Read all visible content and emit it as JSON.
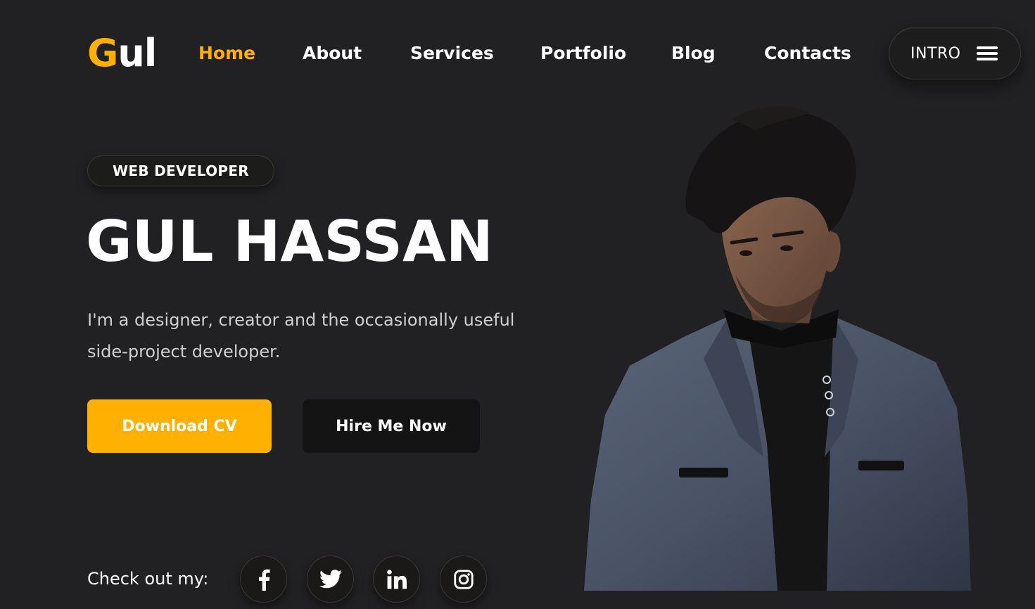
{
  "brand": {
    "logo_first": "G",
    "logo_rest": "ul",
    "accent_color": "#ffb000"
  },
  "nav": {
    "items": [
      {
        "label": "Home",
        "active": true
      },
      {
        "label": "About",
        "active": false
      },
      {
        "label": "Services",
        "active": false
      },
      {
        "label": "Portfolio",
        "active": false
      },
      {
        "label": "Blog",
        "active": false
      },
      {
        "label": "Contacts",
        "active": false
      }
    ],
    "intro_label": "INTRO",
    "menu_icon": "hamburger-menu-icon"
  },
  "hero": {
    "badge": "WEB DEVELOPER",
    "name": "GUL HASSAN",
    "description": "I'm a designer, creator and the occasionally useful side-project developer.",
    "primary_button": "Download CV",
    "secondary_button": "Hire Me Now",
    "portrait_icon": "person-portrait"
  },
  "social": {
    "label": "Check out my:",
    "links": [
      {
        "icon": "facebook-icon"
      },
      {
        "icon": "twitter-icon"
      },
      {
        "icon": "linkedin-icon"
      },
      {
        "icon": "instagram-icon"
      }
    ]
  },
  "colors": {
    "background": "#212022",
    "accent": "#ffb000",
    "dark_button": "#141414",
    "text_muted": "#cfcfcf"
  }
}
